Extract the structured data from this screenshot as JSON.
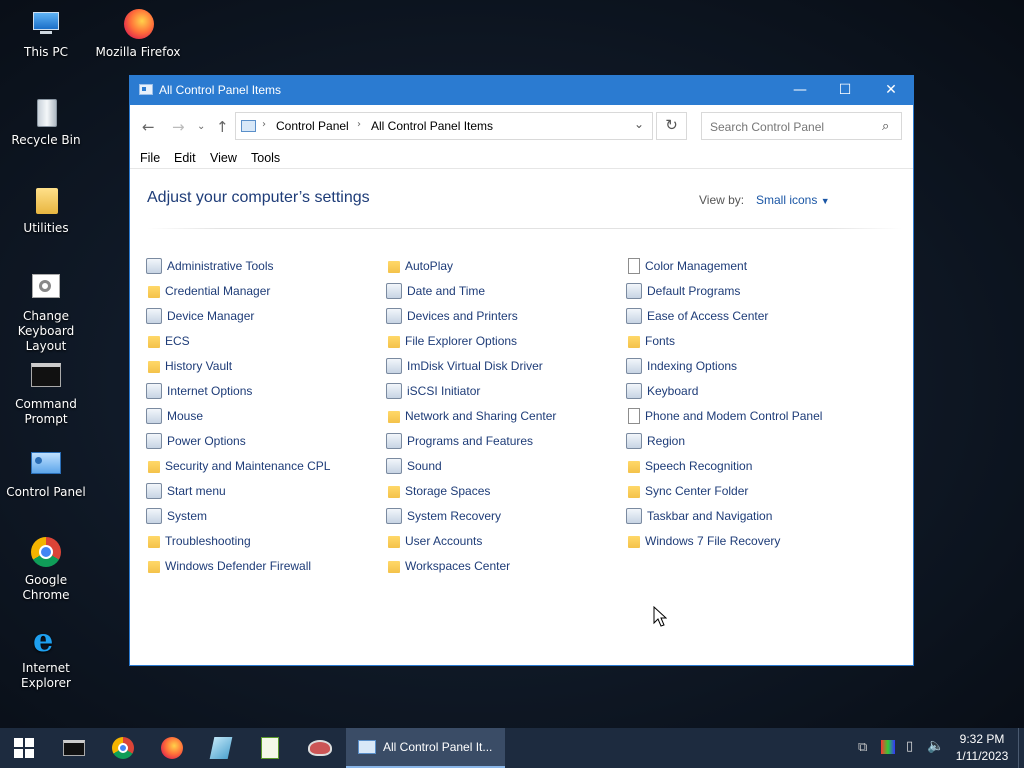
{
  "desktop": {
    "icons": [
      "This PC",
      "Mozilla Firefox",
      "Recycle Bin",
      "Utilities",
      "Change Keyboard Layout",
      "Command Prompt",
      "Control Panel",
      "Google Chrome",
      "Internet Explorer"
    ]
  },
  "window": {
    "title": "All Control Panel Items",
    "controls": {
      "minimize": "—",
      "maximize": "☐",
      "close": "✕"
    }
  },
  "address": {
    "crumbs": [
      "Control Panel",
      "All Control Panel Items"
    ],
    "search_placeholder": "Search Control Panel"
  },
  "menu": [
    "File",
    "Edit",
    "View",
    "Tools"
  ],
  "header": {
    "title": "Adjust your computer’s settings",
    "view_by_label": "View by:",
    "view_by_value": "Small icons"
  },
  "columns": [
    [
      "Administrative Tools",
      "Credential Manager",
      "Device Manager",
      "ECS",
      "History Vault",
      "Internet Options",
      "Mouse",
      "Power Options",
      "Security and Maintenance CPL",
      "Start menu",
      "System",
      "Troubleshooting",
      "Windows Defender Firewall"
    ],
    [
      "AutoPlay",
      "Date and Time",
      "Devices and Printers",
      "File Explorer Options",
      "ImDisk Virtual Disk Driver",
      "iSCSI Initiator",
      "Network and Sharing Center",
      "Programs and Features",
      "Sound",
      "Storage Spaces",
      "System Recovery",
      "User Accounts",
      "Workspaces Center"
    ],
    [
      "Color Management",
      "Default Programs",
      "Ease of Access Center",
      "Fonts",
      "Indexing Options",
      "Keyboard",
      "Phone and Modem Control Panel",
      "Region",
      "Speech Recognition",
      "Sync Center Folder",
      "Taskbar and Navigation",
      "Windows 7 File Recovery"
    ]
  ],
  "taskbar": {
    "active_label": "All Control Panel It...",
    "time": "9:32 PM",
    "date": "1/11/2023"
  }
}
